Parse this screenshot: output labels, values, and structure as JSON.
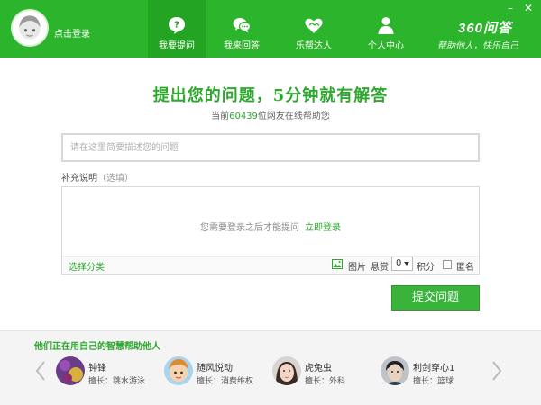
{
  "header": {
    "login_text": "点击登录",
    "nav": [
      {
        "label": "我要提问",
        "active": true,
        "icon": "question-bubble-icon"
      },
      {
        "label": "我来回答",
        "active": false,
        "icon": "chat-bubbles-icon"
      },
      {
        "label": "乐帮达人",
        "active": false,
        "icon": "handshake-heart-icon"
      },
      {
        "label": "个人中心",
        "active": false,
        "icon": "user-icon"
      }
    ],
    "brand": "360问答",
    "slogan": "帮助他人，快乐自己",
    "minimize": "–",
    "close": "✕"
  },
  "main": {
    "headline": "提出您的问题，5分钟就有解答",
    "online_prefix": "当前",
    "online_count": "60439",
    "online_suffix": "位网友在线帮助您",
    "question_placeholder": "请在这里简要描述您的问题",
    "supplement_label": "补充说明",
    "supplement_optional": "（选填）",
    "login_hint": "您需要登录之后才能提问",
    "login_now": "立即登录",
    "select_category": "选择分类",
    "picture_label": "图片",
    "reward_label": "悬赏",
    "reward_value": "0",
    "points_label": "积分",
    "anonymous_label": "匿名",
    "submit_label": "提交问题"
  },
  "footer": {
    "title": "他们正在用自己的智慧帮助他人",
    "helpers": [
      {
        "name": "钟锋",
        "skill": "擅长：跳水游泳"
      },
      {
        "name": "随风悦动",
        "skill": "擅长：消费维权"
      },
      {
        "name": "虎兔虫",
        "skill": "擅长：外科"
      },
      {
        "name": "利剑穿心1",
        "skill": "擅长：篮球"
      }
    ]
  },
  "colors": {
    "brand_green": "#2cb52c",
    "accent_green": "#2ea82e"
  }
}
